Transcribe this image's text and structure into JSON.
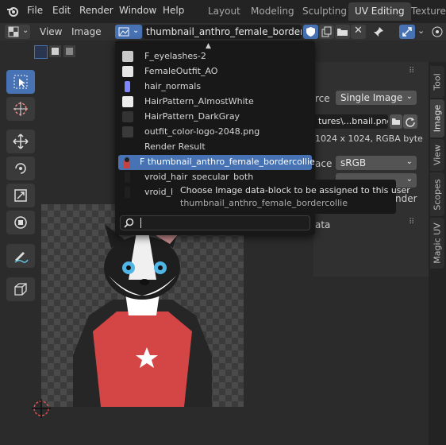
{
  "top_menu": {
    "items": [
      "File",
      "Edit",
      "Render",
      "Window",
      "Help"
    ]
  },
  "workspace_tabs": [
    {
      "label": "Layout",
      "active": false
    },
    {
      "label": "Modeling",
      "active": false
    },
    {
      "label": "Sculpting",
      "active": false
    },
    {
      "label": "UV Editing",
      "active": true
    },
    {
      "label": "Texture P",
      "active": false
    }
  ],
  "header": {
    "view_menu": "View",
    "image_menu": "Image",
    "image_name": "thumbnail_anthro_female_bordercollie"
  },
  "image_dropdown": {
    "items": [
      {
        "label": "F_eyelashes-2",
        "thumb": "#c8c8c8"
      },
      {
        "label": "FemaleOutfit_AO",
        "thumb": "#e6e6e6"
      },
      {
        "label": "hair_normals",
        "thumb": "#7f86ff"
      },
      {
        "label": "HairPattern_AlmostWhite",
        "thumb": "#ececec"
      },
      {
        "label": "HairPattern_DarkGray",
        "thumb": "#333333"
      },
      {
        "label": "outfit_color-logo-2048.png",
        "thumb": "#3a3a3a"
      },
      {
        "label": "Render Result",
        "thumb": "none"
      },
      {
        "label": "F thumbnail_anthro_female_bordercollie",
        "thumb": "#c54242",
        "selected": true
      },
      {
        "label": "vroid_hair_specular_both",
        "thumb": "#202020"
      },
      {
        "label": "vroid_l",
        "thumb": "#202020"
      }
    ],
    "search_value": ""
  },
  "tooltip": {
    "title": "Choose Image data-block to be assigned to this user",
    "subtitle": "thumbnail_anthro_female_bordercollie"
  },
  "image_panel": {
    "source_label": "rce",
    "source_value": "Single Image",
    "filepath_value": "tures\\...bnail.png",
    "info": "1024 x 1024,  RGBA byte",
    "colorspace_label": "ace",
    "colorspace_value": "sRGB",
    "alpha_label": "nder",
    "metadata_label": "ata"
  },
  "side_tabs": [
    {
      "label": "Tool",
      "active": false
    },
    {
      "label": "Image",
      "active": true
    },
    {
      "label": "View",
      "active": false
    },
    {
      "label": "Scopes",
      "active": false
    },
    {
      "label": "Magic UV",
      "active": false
    }
  ],
  "colors": {
    "accent": "#4772b3",
    "topbar": "#232323",
    "dropdown_bg": "#181818"
  }
}
